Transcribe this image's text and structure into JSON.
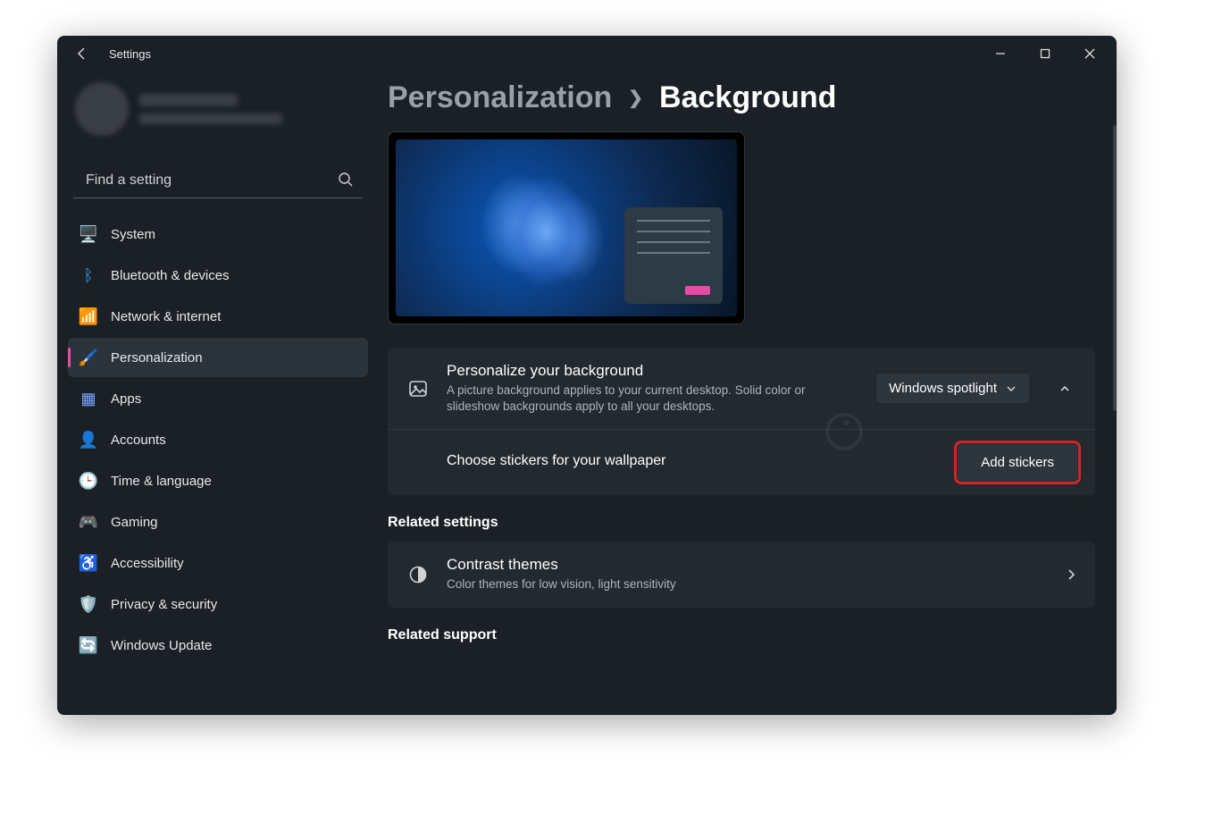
{
  "window": {
    "title": "Settings"
  },
  "search": {
    "placeholder": "Find a setting"
  },
  "sidebar": {
    "items": [
      {
        "label": "System",
        "icon": "🖥️",
        "color": "#3aa0ff"
      },
      {
        "label": "Bluetooth & devices",
        "icon": "ᛒ",
        "color": "#3aa0ff"
      },
      {
        "label": "Network & internet",
        "icon": "📶",
        "color": "#3aa0ff"
      },
      {
        "label": "Personalization",
        "icon": "🖌️",
        "color": "#e0a060"
      },
      {
        "label": "Apps",
        "icon": "▦",
        "color": "#7aa8ff"
      },
      {
        "label": "Accounts",
        "icon": "👤",
        "color": "#2ec46a"
      },
      {
        "label": "Time & language",
        "icon": "🕒",
        "color": "#3aa0ff"
      },
      {
        "label": "Gaming",
        "icon": "🎮",
        "color": "#b9bdc2"
      },
      {
        "label": "Accessibility",
        "icon": "♿",
        "color": "#3aa0ff"
      },
      {
        "label": "Privacy & security",
        "icon": "🛡️",
        "color": "#b9bdc2"
      },
      {
        "label": "Windows Update",
        "icon": "🔄",
        "color": "#2ec46a"
      }
    ],
    "active_index": 3
  },
  "breadcrumb": {
    "root": "Personalization",
    "current": "Background"
  },
  "personalize": {
    "title": "Personalize your background",
    "desc": "A picture background applies to your current desktop. Solid color or slideshow backgrounds apply to all your desktops.",
    "dropdown": "Windows spotlight"
  },
  "stickers": {
    "label": "Choose stickers for your wallpaper",
    "button": "Add stickers"
  },
  "related_settings": {
    "heading": "Related settings",
    "contrast_title": "Contrast themes",
    "contrast_desc": "Color themes for low vision, light sensitivity"
  },
  "related_support": {
    "heading": "Related support"
  }
}
